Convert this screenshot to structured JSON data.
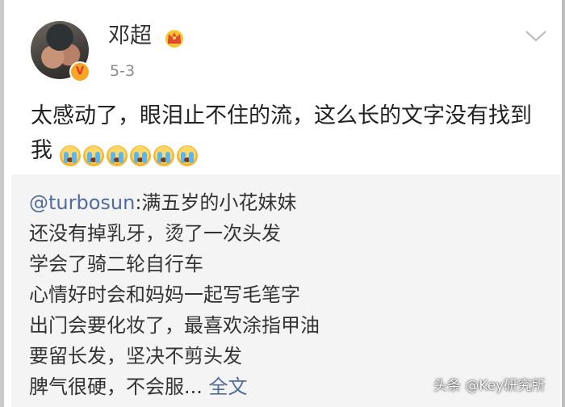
{
  "post": {
    "author": {
      "name": "邓超",
      "verified_badge": "V"
    },
    "date": "5-3",
    "text": "太感动了，眼泪止不住的流，这么长的文字没有找到我",
    "emoji_count": 6,
    "emoji_icon": "crying-face-icon"
  },
  "repost": {
    "mention": "@turbosun",
    "lines": [
      ":满五岁的小花妹妹",
      "还没有掉乳牙，烫了一次头发",
      "学会了骑二轮自行车",
      "心情好时会和妈妈一起写毛笔字",
      "出门会要化妆了，最喜欢涂指甲油",
      "要留长发，坚决不剪头发",
      "脾气很硬，不会服..."
    ],
    "more_label": "全文"
  },
  "watermark": "头条 @Key研究所",
  "colors": {
    "link": "#506c9c",
    "repost_background": "#f4f4f4",
    "badge": "#f6a623"
  }
}
